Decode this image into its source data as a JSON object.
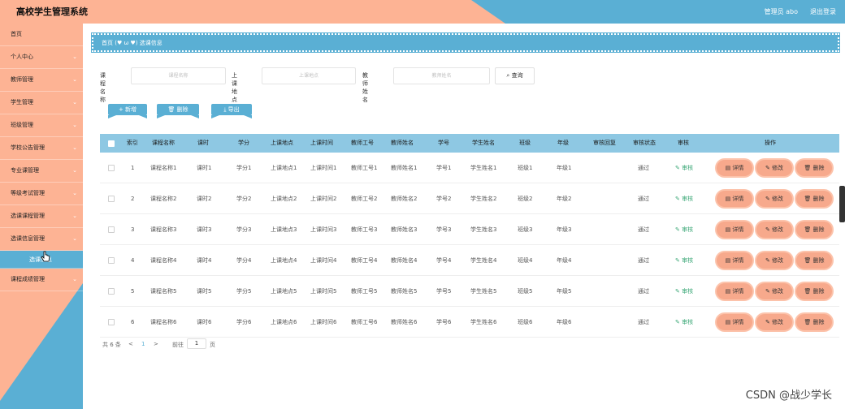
{
  "header": {
    "title": "高校学生管理系统",
    "admin": "管理员 abo",
    "logout": "退出登录"
  },
  "sidebar": {
    "items": [
      {
        "label": "首页",
        "chev": ""
      },
      {
        "label": "个人中心",
        "chev": "⌄"
      },
      {
        "label": "教师管理",
        "chev": "⌄"
      },
      {
        "label": "学生管理",
        "chev": "⌄"
      },
      {
        "label": "班级管理",
        "chev": "⌄"
      },
      {
        "label": "学校公告管理",
        "chev": "⌄"
      },
      {
        "label": "专业课管理",
        "chev": "⌄"
      },
      {
        "label": "等级考试管理",
        "chev": "⌄"
      },
      {
        "label": "选课课程管理",
        "chev": "⌄"
      },
      {
        "label": "选课信息管理",
        "chev": "⌄"
      }
    ],
    "subitem": "选课信息",
    "last": {
      "label": "课程成绩管理",
      "chev": "⌄"
    }
  },
  "breadcrumb": {
    "home": "首页",
    "emoticon": "(♥ ω ♥)",
    "current": "选课信息"
  },
  "search": {
    "course_label": "课程名称",
    "course_placeholder": "课程名称",
    "place_label": "上课地点",
    "place_placeholder": "上课地点",
    "teacher_label": "教师姓名",
    "teacher_placeholder": "教师姓名",
    "button": "查询"
  },
  "actions": {
    "add": "+ 新增",
    "delete": "删除",
    "export": "导出"
  },
  "table": {
    "headers": [
      "索引",
      "课程名称",
      "课时",
      "学分",
      "上课地点",
      "上课时间",
      "教师工号",
      "教师姓名",
      "学号",
      "学生姓名",
      "班级",
      "年级",
      "审核回复",
      "审核状态",
      "审核",
      "操作"
    ],
    "rows": [
      {
        "idx": "1",
        "name": "课程名称1",
        "hours": "课时1",
        "credit": "学分1",
        "place": "上课地点1",
        "time": "上课时间1",
        "tid": "教师工号1",
        "tname": "教师姓名1",
        "sid": "学号1",
        "sname": "学生姓名1",
        "cls": "班级1",
        "grade": "年级1",
        "reply": "",
        "status": "通过",
        "audit": "审核"
      },
      {
        "idx": "2",
        "name": "课程名称2",
        "hours": "课时2",
        "credit": "学分2",
        "place": "上课地点2",
        "time": "上课时间2",
        "tid": "教师工号2",
        "tname": "教师姓名2",
        "sid": "学号2",
        "sname": "学生姓名2",
        "cls": "班级2",
        "grade": "年级2",
        "reply": "",
        "status": "通过",
        "audit": "审核"
      },
      {
        "idx": "3",
        "name": "课程名称3",
        "hours": "课时3",
        "credit": "学分3",
        "place": "上课地点3",
        "time": "上课时间3",
        "tid": "教师工号3",
        "tname": "教师姓名3",
        "sid": "学号3",
        "sname": "学生姓名3",
        "cls": "班级3",
        "grade": "年级3",
        "reply": "",
        "status": "通过",
        "audit": "审核"
      },
      {
        "idx": "4",
        "name": "课程名称4",
        "hours": "课时4",
        "credit": "学分4",
        "place": "上课地点4",
        "time": "上课时间4",
        "tid": "教师工号4",
        "tname": "教师姓名4",
        "sid": "学号4",
        "sname": "学生姓名4",
        "cls": "班级4",
        "grade": "年级4",
        "reply": "",
        "status": "通过",
        "audit": "审核"
      },
      {
        "idx": "5",
        "name": "课程名称5",
        "hours": "课时5",
        "credit": "学分5",
        "place": "上课地点5",
        "time": "上课时间5",
        "tid": "教师工号5",
        "tname": "教师姓名5",
        "sid": "学号5",
        "sname": "学生姓名5",
        "cls": "班级5",
        "grade": "年级5",
        "reply": "",
        "status": "通过",
        "audit": "审核"
      },
      {
        "idx": "6",
        "name": "课程名称6",
        "hours": "课时6",
        "credit": "学分6",
        "place": "上课地点6",
        "time": "上课时间6",
        "tid": "教师工号6",
        "tname": "教师姓名6",
        "sid": "学号6",
        "sname": "学生姓名6",
        "cls": "班级6",
        "grade": "年级6",
        "reply": "",
        "status": "通过",
        "audit": "审核"
      }
    ],
    "ops": {
      "detail": "详情",
      "edit": "修改",
      "delete": "删除"
    }
  },
  "pager": {
    "total": "共 6 条",
    "prev": "<",
    "page": "1",
    "next": ">",
    "goto": "前往",
    "page_input": "1",
    "page_unit": "页"
  },
  "colors": {
    "peach": "#fdb394",
    "blue": "#5aafd4",
    "header_row": "#8ec8e3",
    "op_button": "#f7a98c"
  },
  "watermark": "CSDN @战少学长"
}
